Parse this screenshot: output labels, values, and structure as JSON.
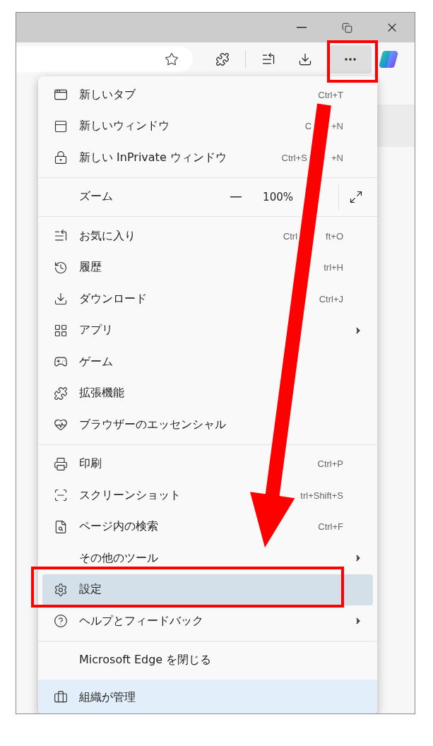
{
  "toolbar": {
    "more_button": {
      "pressed": true
    }
  },
  "menu": {
    "sections": [
      [
        {
          "kind": "item",
          "label": "新しいタブ",
          "shortcut": "Ctrl+T",
          "submenu": false,
          "selected": false
        },
        {
          "kind": "item",
          "label": "新しいウィンドウ",
          "shortcut_parts": [
            "C",
            "+N"
          ],
          "submenu": false,
          "selected": false
        },
        {
          "kind": "item",
          "label": "新しい InPrivate ウィンドウ",
          "shortcut_parts": [
            "Ctrl+S",
            "+N"
          ],
          "submenu": false,
          "selected": false
        }
      ],
      [
        {
          "kind": "zoom",
          "label": "ズーム",
          "value": "100%",
          "selected": false
        }
      ],
      [
        {
          "kind": "item",
          "label": "お気に入り",
          "shortcut_parts": [
            "Ctrl",
            "ft+O"
          ],
          "submenu": false,
          "selected": false
        },
        {
          "kind": "item",
          "label": "履歴",
          "shortcut": "trl+H",
          "submenu": false,
          "selected": false
        },
        {
          "kind": "item",
          "label": "ダウンロード",
          "shortcut": "Ctrl+J",
          "submenu": false,
          "selected": false
        },
        {
          "kind": "item",
          "label": "アプリ",
          "submenu": true,
          "selected": false
        },
        {
          "kind": "item",
          "label": "ゲーム",
          "submenu": false,
          "selected": false
        },
        {
          "kind": "item",
          "label": "拡張機能",
          "submenu": false,
          "selected": false
        },
        {
          "kind": "item",
          "label": "ブラウザーのエッセンシャル",
          "submenu": false,
          "selected": false
        }
      ],
      [
        {
          "kind": "item",
          "label": "印刷",
          "shortcut": "Ctrl+P",
          "submenu": false,
          "selected": false
        },
        {
          "kind": "item",
          "label": "スクリーンショット",
          "shortcut": "trl+Shift+S",
          "submenu": false,
          "selected": false
        },
        {
          "kind": "item",
          "label": "ページ内の検索",
          "shortcut": "Ctrl+F",
          "submenu": false,
          "selected": false
        },
        {
          "kind": "item",
          "label": "その他のツール",
          "submenu": true,
          "selected": false
        },
        {
          "kind": "item",
          "label": "設定",
          "submenu": false,
          "selected": true
        },
        {
          "kind": "item",
          "label": "ヘルプとフィードバック",
          "submenu": true,
          "selected": false
        }
      ],
      [
        {
          "kind": "item",
          "label": "Microsoft Edge を閉じる",
          "submenu": false,
          "selected": false
        }
      ]
    ],
    "footer": {
      "label": "組織が管理"
    }
  }
}
